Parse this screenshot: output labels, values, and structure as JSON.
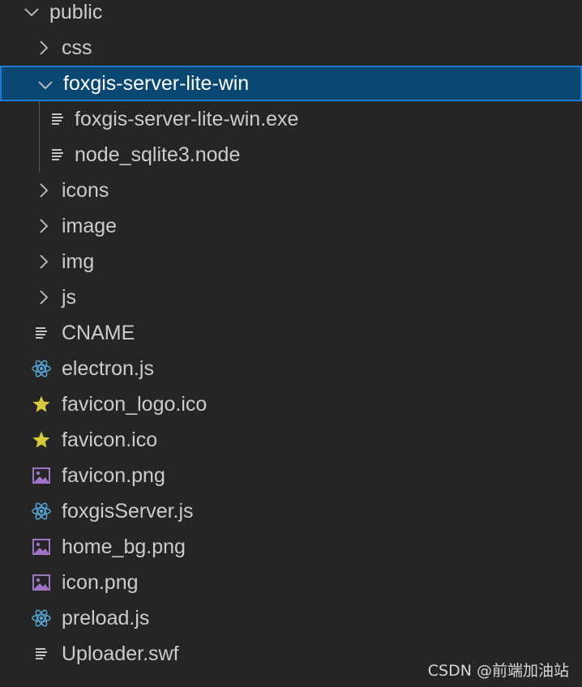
{
  "explorer": {
    "items": [
      {
        "label": "public",
        "kind": "folder-open",
        "depth": 0
      },
      {
        "label": "css",
        "kind": "folder-closed",
        "depth": 1
      },
      {
        "label": "foxgis-server-lite-win",
        "kind": "folder-open",
        "depth": 1,
        "selected": true
      },
      {
        "label": "foxgis-server-lite-win.exe",
        "kind": "file-lines",
        "depth": 2
      },
      {
        "label": "node_sqlite3.node",
        "kind": "file-lines",
        "depth": 2
      },
      {
        "label": "icons",
        "kind": "folder-closed",
        "depth": 1
      },
      {
        "label": "image",
        "kind": "folder-closed",
        "depth": 1
      },
      {
        "label": "img",
        "kind": "folder-closed",
        "depth": 1
      },
      {
        "label": "js",
        "kind": "folder-closed",
        "depth": 1
      },
      {
        "label": "CNAME",
        "kind": "file-lines",
        "depth": 1
      },
      {
        "label": "electron.js",
        "kind": "react-atom",
        "depth": 1
      },
      {
        "label": "favicon_logo.ico",
        "kind": "star",
        "depth": 1
      },
      {
        "label": "favicon.ico",
        "kind": "star",
        "depth": 1
      },
      {
        "label": "favicon.png",
        "kind": "image",
        "depth": 1
      },
      {
        "label": "foxgisServer.js",
        "kind": "react-atom",
        "depth": 1
      },
      {
        "label": "home_bg.png",
        "kind": "image",
        "depth": 1
      },
      {
        "label": "icon.png",
        "kind": "image",
        "depth": 1
      },
      {
        "label": "preload.js",
        "kind": "react-atom",
        "depth": 1
      },
      {
        "label": "Uploader.swf",
        "kind": "file-lines",
        "depth": 1
      }
    ]
  },
  "watermark": "CSDN @前端加油站",
  "colors": {
    "background": "#252526",
    "selection": "#094771",
    "selection_border": "#1f7bd0",
    "atom": "#58a6d6",
    "star": "#d7c83e",
    "image": "#a074c4",
    "text": "#cccccc"
  }
}
